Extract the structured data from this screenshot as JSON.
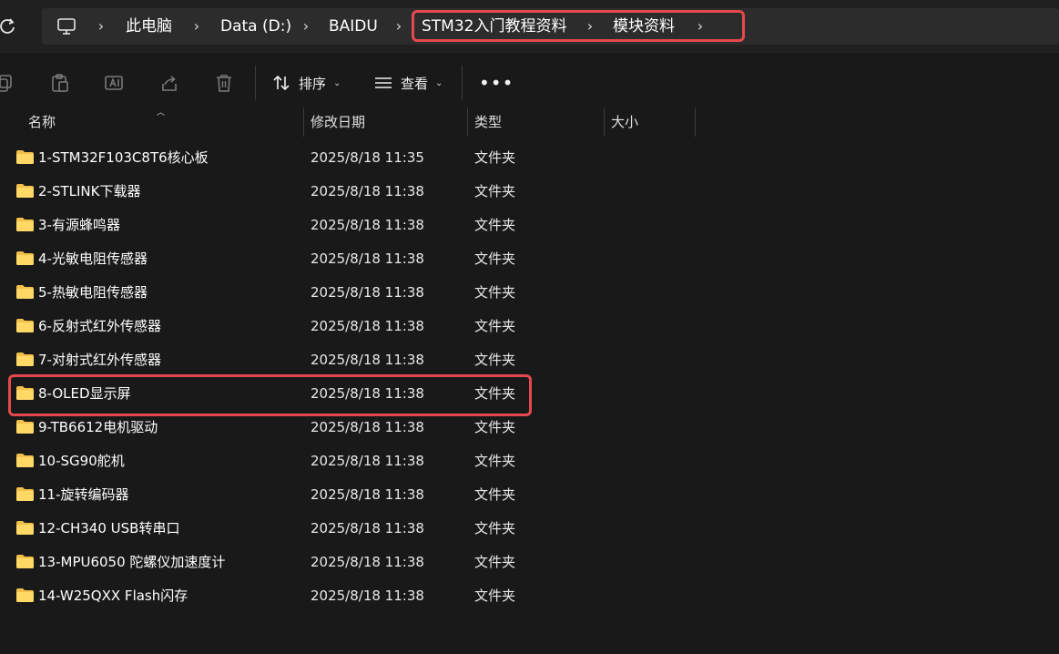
{
  "address_bar": {
    "crumbs": [
      "此电脑",
      "Data (D:)",
      "BAIDU",
      "STM32入门教程资料",
      "模块资料"
    ],
    "separator": "›"
  },
  "toolbar": {
    "sort_label": "排序",
    "view_label": "查看",
    "more_label": "•••",
    "icons": [
      "copy-icon",
      "paste-icon",
      "rename-icon",
      "share-icon",
      "delete-icon",
      "sort-icon",
      "view-icon",
      "more-icon"
    ]
  },
  "columns": {
    "name": "名称",
    "date": "修改日期",
    "type": "类型",
    "size": "大小"
  },
  "files": [
    {
      "name": "1-STM32F103C8T6核心板",
      "date": "2025/8/18 11:35",
      "type": "文件夹"
    },
    {
      "name": "2-STLINK下载器",
      "date": "2025/8/18 11:38",
      "type": "文件夹"
    },
    {
      "name": "3-有源蜂鸣器",
      "date": "2025/8/18 11:38",
      "type": "文件夹"
    },
    {
      "name": "4-光敏电阻传感器",
      "date": "2025/8/18 11:38",
      "type": "文件夹"
    },
    {
      "name": "5-热敏电阻传感器",
      "date": "2025/8/18 11:38",
      "type": "文件夹"
    },
    {
      "name": "6-反射式红外传感器",
      "date": "2025/8/18 11:38",
      "type": "文件夹"
    },
    {
      "name": "7-对射式红外传感器",
      "date": "2025/8/18 11:38",
      "type": "文件夹"
    },
    {
      "name": "8-OLED显示屏",
      "date": "2025/8/18 11:38",
      "type": "文件夹"
    },
    {
      "name": "9-TB6612电机驱动",
      "date": "2025/8/18 11:38",
      "type": "文件夹"
    },
    {
      "name": "10-SG90舵机",
      "date": "2025/8/18 11:38",
      "type": "文件夹"
    },
    {
      "name": "11-旋转编码器",
      "date": "2025/8/18 11:38",
      "type": "文件夹"
    },
    {
      "name": "12-CH340 USB转串口",
      "date": "2025/8/18 11:38",
      "type": "文件夹"
    },
    {
      "name": "13-MPU6050 陀螺仪加速度计",
      "date": "2025/8/18 11:38",
      "type": "文件夹"
    },
    {
      "name": "14-W25QXX Flash闪存",
      "date": "2025/8/18 11:38",
      "type": "文件夹"
    }
  ],
  "colors": {
    "highlight": "#e5484d",
    "folder": "#f2c04a",
    "background": "#191919"
  }
}
